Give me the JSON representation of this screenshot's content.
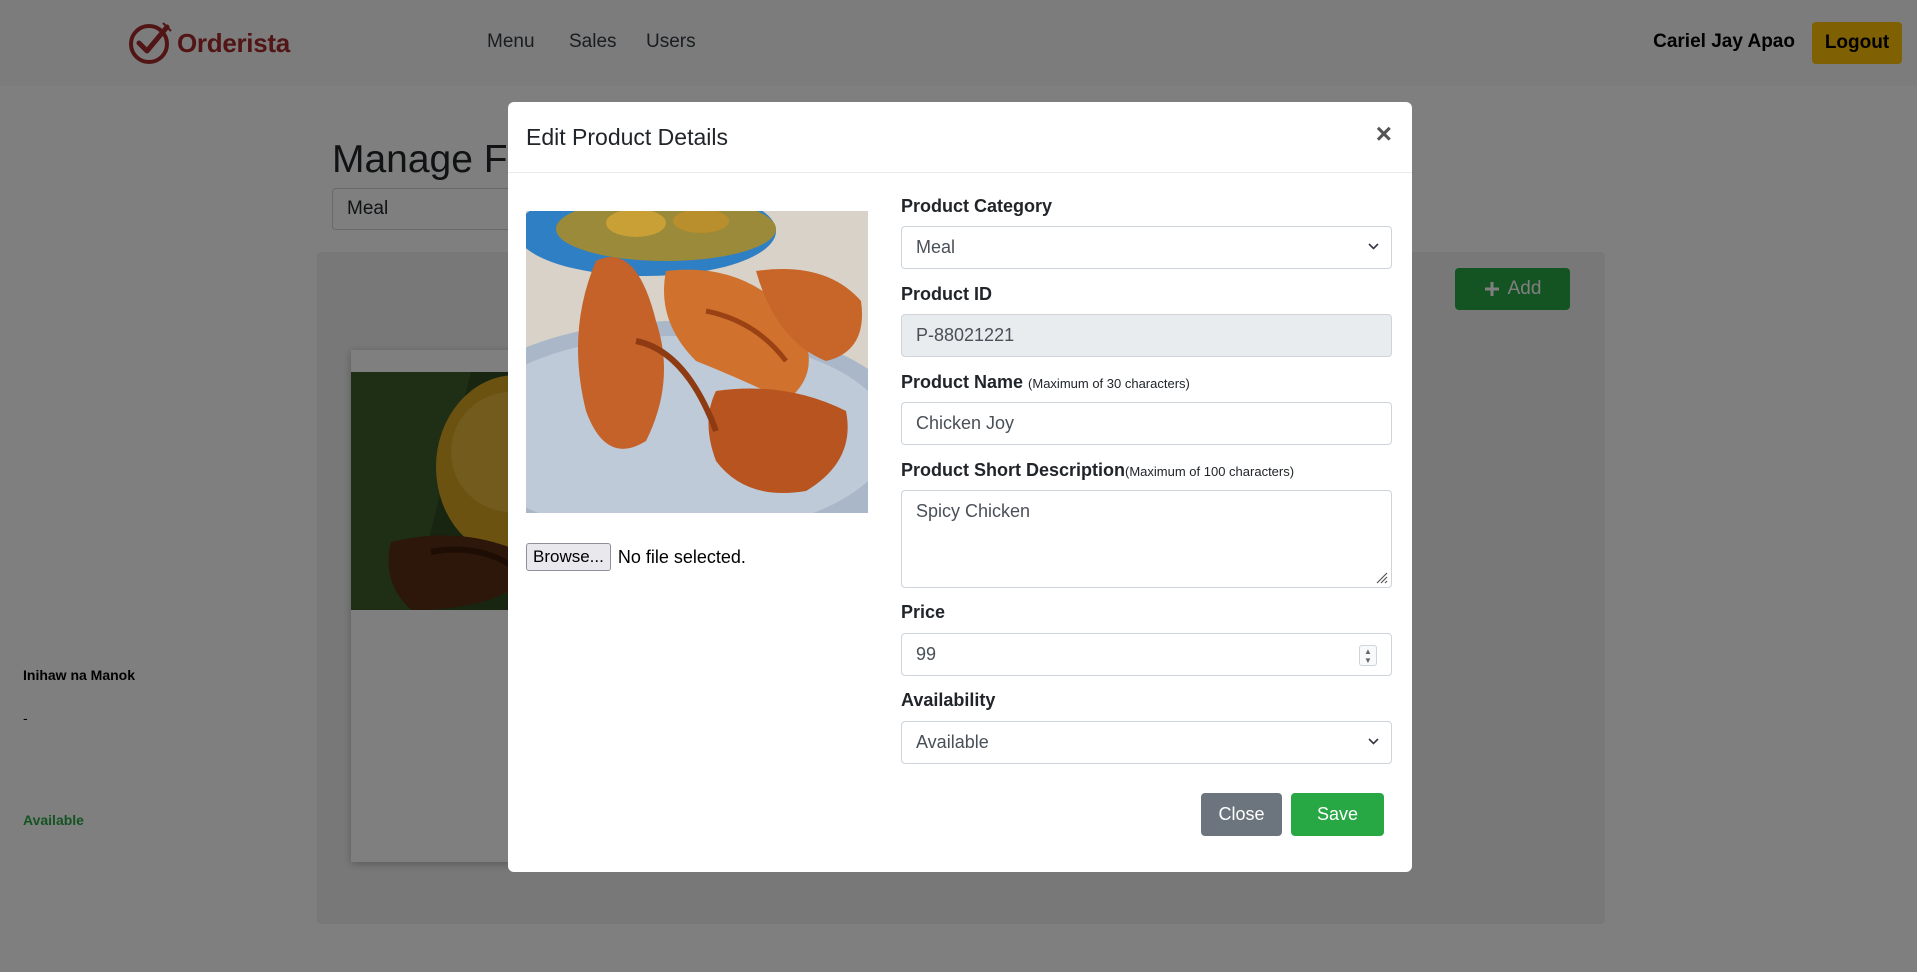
{
  "app": {
    "brand": "Orderista"
  },
  "nav": {
    "links": [
      {
        "label": "Menu"
      },
      {
        "label": "Sales"
      },
      {
        "label": "Users"
      }
    ],
    "user_name": "Cariel Jay Apao",
    "logout_label": "Logout"
  },
  "page": {
    "title": "Manage Fo",
    "category_value": "Meal",
    "add_label": "Add",
    "card": {
      "name": "Inihaw na Manok",
      "description": "-",
      "status": "Available"
    }
  },
  "modal": {
    "title": "Edit Product Details",
    "close_symbol": "×",
    "browse_label": "Browse...",
    "file_status": "No file selected.",
    "fields": {
      "category": {
        "label": "Product Category",
        "value": "Meal"
      },
      "product_id": {
        "label": "Product ID",
        "value": "P-88021221"
      },
      "product_name": {
        "label": "Product Name",
        "hint": "(Maximum of 30 characters)",
        "value": "Chicken Joy"
      },
      "description": {
        "label": "Product Short Description",
        "hint": "(Maximum of 100 characters)",
        "value": "Spicy Chicken"
      },
      "price": {
        "label": "Price",
        "value": "99"
      },
      "availability": {
        "label": "Availability",
        "value": "Available"
      }
    },
    "close_label": "Close",
    "save_label": "Save"
  },
  "colors": {
    "brand": "#a52a2a",
    "logout": "#ffc107",
    "primary_action": "#28a745",
    "secondary_action": "#6c757d"
  },
  "icons": [
    "logo-icon",
    "plus-icon",
    "close-icon",
    "chevron-down-icon",
    "spinner-icon",
    "resize-grip-icon"
  ]
}
